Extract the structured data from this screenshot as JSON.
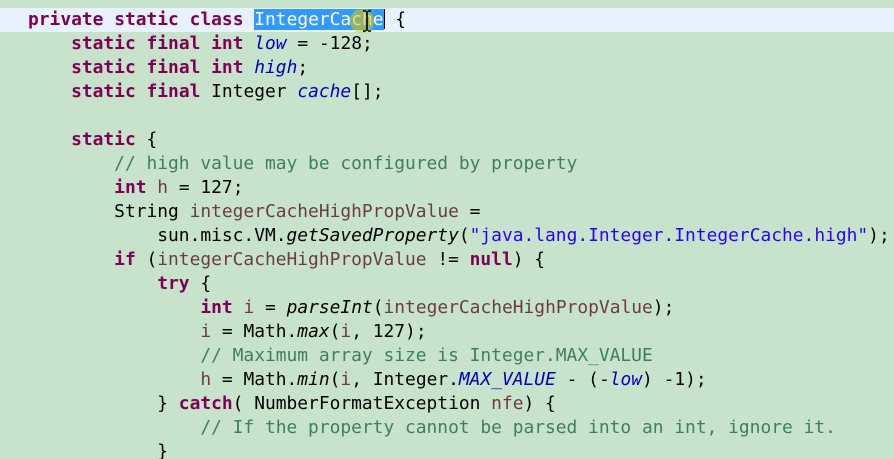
{
  "editor": {
    "selected_identifier": "IntegerCache",
    "lines": [
      [
        [
          "private",
          "kw"
        ],
        [
          " ",
          ""
        ],
        [
          "static",
          "kw"
        ],
        [
          " ",
          ""
        ],
        [
          "class",
          "kw"
        ],
        [
          " ",
          ""
        ],
        [
          "IntegerCache",
          "sel"
        ],
        [
          " {",
          ""
        ]
      ],
      [
        [
          "    ",
          ""
        ],
        [
          "static",
          "kw"
        ],
        [
          " ",
          ""
        ],
        [
          "final",
          "kw"
        ],
        [
          " ",
          ""
        ],
        [
          "int",
          "kw"
        ],
        [
          " ",
          ""
        ],
        [
          "low",
          "fld"
        ],
        [
          " = -128;",
          ""
        ]
      ],
      [
        [
          "    ",
          ""
        ],
        [
          "static",
          "kw"
        ],
        [
          " ",
          ""
        ],
        [
          "final",
          "kw"
        ],
        [
          " ",
          ""
        ],
        [
          "int",
          "kw"
        ],
        [
          " ",
          ""
        ],
        [
          "high",
          "fld"
        ],
        [
          ";",
          ""
        ]
      ],
      [
        [
          "    ",
          ""
        ],
        [
          "static",
          "kw"
        ],
        [
          " ",
          ""
        ],
        [
          "final",
          "kw"
        ],
        [
          " Integer ",
          ""
        ],
        [
          "cache",
          "fld"
        ],
        [
          "[];",
          ""
        ]
      ],
      [
        [
          "",
          ""
        ]
      ],
      [
        [
          "    ",
          ""
        ],
        [
          "static",
          "kw"
        ],
        [
          " {",
          ""
        ]
      ],
      [
        [
          "        ",
          ""
        ],
        [
          "// high value may be configured by property",
          "cmt"
        ]
      ],
      [
        [
          "        ",
          ""
        ],
        [
          "int",
          "kw"
        ],
        [
          " ",
          ""
        ],
        [
          "h",
          "var"
        ],
        [
          " = 127;",
          ""
        ]
      ],
      [
        [
          "        String ",
          ""
        ],
        [
          "integerCacheHighPropValue",
          "var"
        ],
        [
          " =",
          ""
        ]
      ],
      [
        [
          "            sun.misc.VM.",
          ""
        ],
        [
          "getSavedProperty",
          "mth"
        ],
        [
          "(",
          ""
        ],
        [
          "\"java.lang.Integer.IntegerCache.high\"",
          "str"
        ],
        [
          ");",
          ""
        ]
      ],
      [
        [
          "        ",
          ""
        ],
        [
          "if",
          "kw"
        ],
        [
          " (",
          ""
        ],
        [
          "integerCacheHighPropValue",
          "var"
        ],
        [
          " != ",
          ""
        ],
        [
          "null",
          "kw"
        ],
        [
          ") {",
          ""
        ]
      ],
      [
        [
          "            ",
          ""
        ],
        [
          "try",
          "kw"
        ],
        [
          " {",
          ""
        ]
      ],
      [
        [
          "                ",
          ""
        ],
        [
          "int",
          "kw"
        ],
        [
          " ",
          ""
        ],
        [
          "i",
          "var"
        ],
        [
          " = ",
          ""
        ],
        [
          "parseInt",
          "mth"
        ],
        [
          "(",
          ""
        ],
        [
          "integerCacheHighPropValue",
          "var"
        ],
        [
          ");",
          ""
        ]
      ],
      [
        [
          "                ",
          ""
        ],
        [
          "i",
          "var"
        ],
        [
          " = Math.",
          ""
        ],
        [
          "max",
          "mth"
        ],
        [
          "(",
          ""
        ],
        [
          "i",
          "var"
        ],
        [
          ", 127);",
          ""
        ]
      ],
      [
        [
          "                ",
          ""
        ],
        [
          "// Maximum array size is Integer.MAX_VALUE",
          "cmt"
        ]
      ],
      [
        [
          "                ",
          ""
        ],
        [
          "h",
          "var"
        ],
        [
          " = Math.",
          ""
        ],
        [
          "min",
          "mth"
        ],
        [
          "(",
          ""
        ],
        [
          "i",
          "var"
        ],
        [
          ", Integer.",
          ""
        ],
        [
          "MAX_VALUE",
          "fld"
        ],
        [
          " - (-",
          ""
        ],
        [
          "low",
          "fld"
        ],
        [
          ") -1);",
          ""
        ]
      ],
      [
        [
          "            } ",
          ""
        ],
        [
          "catch",
          "kw"
        ],
        [
          "( NumberFormatException ",
          ""
        ],
        [
          "nfe",
          "var"
        ],
        [
          ") {",
          ""
        ]
      ],
      [
        [
          "                ",
          ""
        ],
        [
          "// If the property cannot be parsed into an int, ignore it.",
          "cmt"
        ]
      ],
      [
        [
          "            }",
          ""
        ]
      ]
    ]
  }
}
